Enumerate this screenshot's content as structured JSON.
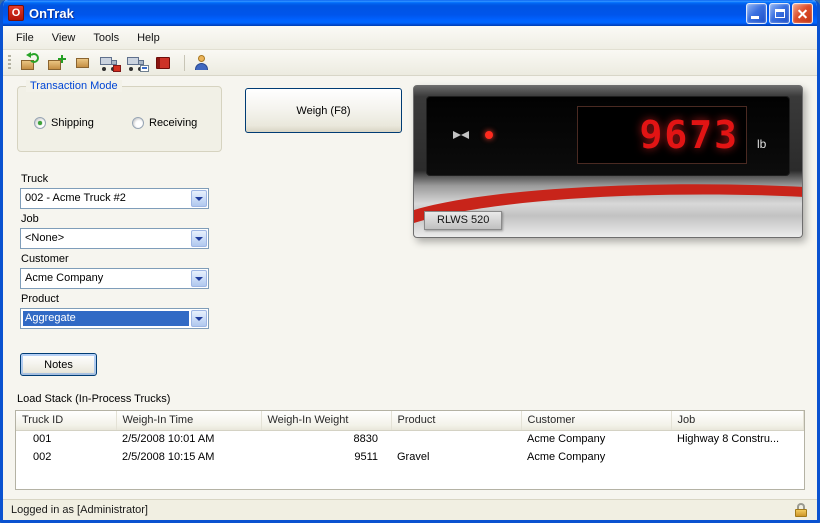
{
  "window": {
    "title": "OnTrak",
    "logo_letter": "O"
  },
  "menu": {
    "items": [
      "File",
      "View",
      "Tools",
      "Help"
    ]
  },
  "toolbar": {
    "icons": [
      "sync-transaction-icon",
      "new-load-icon",
      "product-box-icon",
      "truck-finance-icon",
      "truck-card-icon",
      "reports-book-icon",
      "user-accounts-icon"
    ]
  },
  "transaction_mode": {
    "title": "Transaction Mode",
    "options": [
      {
        "label": "Shipping",
        "selected": true
      },
      {
        "label": "Receiving",
        "selected": false
      }
    ]
  },
  "weigh_button": {
    "label": "Weigh (F8)"
  },
  "scale": {
    "value": "9673",
    "unit": "lb",
    "model": "RLWS 520"
  },
  "fields": {
    "truck": {
      "label": "Truck",
      "value": "002 - Acme Truck #2"
    },
    "job": {
      "label": "Job",
      "value": "<None>"
    },
    "customer": {
      "label": "Customer",
      "value": "Acme Company"
    },
    "product": {
      "label": "Product",
      "value": "Aggregate",
      "highlighted": true
    }
  },
  "notes_button": {
    "label": "Notes"
  },
  "load_stack": {
    "title": "Load Stack (In-Process Trucks)",
    "columns": [
      "Truck ID",
      "Weigh-In Time",
      "Weigh-In Weight",
      "Product",
      "Customer",
      "Job"
    ],
    "rows": [
      [
        "001",
        "2/5/2008 10:01 AM",
        "8830",
        "",
        "Acme Company",
        "Highway 8 Constru..."
      ],
      [
        "002",
        "2/5/2008 10:15 AM",
        "9511",
        "Gravel",
        "Acme Company",
        ""
      ]
    ]
  },
  "status_bar": {
    "text": "Logged in as [Administrator]"
  }
}
